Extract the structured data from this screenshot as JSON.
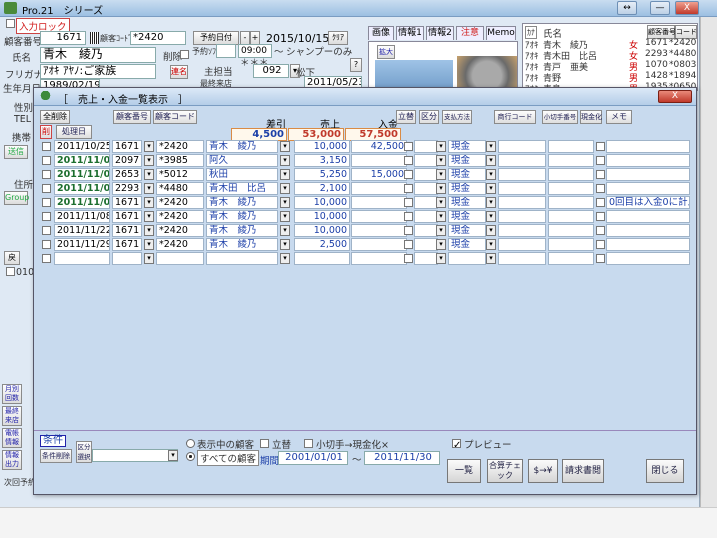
{
  "app": {
    "title": "Pro.21　シリーズ",
    "minimize": "—",
    "close": "X",
    "restore": "↔"
  },
  "form": {
    "input_lock_label": "入力ロック",
    "customer_no_label": "顧客番号",
    "customer_no": "1671",
    "customer_code_label": "顧客ｺｰﾄﾞ",
    "customer_code": "*2420",
    "reservation_date_btn": "予約日付",
    "date_prev": "-",
    "date_next": "+",
    "reservation_date": "2015/10/15",
    "clear_btn": "ｸﾘｱ",
    "name_label": "氏名",
    "name": "青木　綾乃",
    "delete_label": "削除",
    "reservation_time_label": "予約ｿﾌﾄ",
    "time": "09:00",
    "time_tilde": "～",
    "menu": "シャンプーのみ",
    "stars": "＊＊＊",
    "help_btn": "?",
    "kana_label": "フリガナ",
    "kana": "ｱｵｷ ｱﾔﾉ:ご家族",
    "contact_btn": "連名",
    "staff_label": "主担当",
    "staff_code": "092",
    "staff_name": "松下",
    "birthday_label": "生年月日",
    "birthday": "1989/02/19",
    "last_visit_label": "最終来店",
    "last_visit": "2011/05/23",
    "gender_label": "性別",
    "tel_label": "TEL",
    "mobile_label": "携帯",
    "send_btn": "送信",
    "address_label": "住所",
    "group_btn": "Group",
    "return_btn": "戻",
    "side_btn1": "月別回数",
    "side_btn2": "最終来店",
    "side_btn3": "電帳情報",
    "side_btn4": "情報出力",
    "side_label": "次回予約",
    "code_sample": "010"
  },
  "tabs": [
    "画像",
    "情報1",
    "情報2",
    "注意",
    "Memo"
  ],
  "image_panel": {
    "expand_btn": "拡大"
  },
  "customer_list": {
    "header_kana": "ｶﾅ",
    "header_name": "氏名",
    "header_no": "顧客番号",
    "header_code": "コード",
    "rows": [
      {
        "kana": "ｱｵｷ",
        "name": "青木　綾乃",
        "gender": "女",
        "no": "1671",
        "code": "*2420"
      },
      {
        "kana": "ｱｵｷ",
        "name": "青木田　比呂",
        "gender": "女",
        "no": "2293",
        "code": "*4480"
      },
      {
        "kana": "ｱｵｷ",
        "name": "青戸　亜美",
        "gender": "男",
        "no": "1070",
        "code": "*0803"
      },
      {
        "kana": "ｱｵｷ",
        "name": "青野",
        "gender": "男",
        "no": "1428",
        "code": "*1894"
      },
      {
        "kana": "ｱｵｷ",
        "name": "青島",
        "gender": "男",
        "no": "1935",
        "code": "*0650"
      }
    ]
  },
  "dialog": {
    "title": "［　売上・入金一覧表示　］",
    "close": "X",
    "delete_all_btn": "全削除",
    "delete_marker": "削",
    "processing_date_btn": "処理日",
    "customer_no_btn": "顧客番号",
    "customer_code_btn": "顧客コード",
    "col_balance": "差引",
    "col_sales": "売上",
    "col_payment": "入金",
    "col_transfer_btn": "立替",
    "col_category_btn": "区分",
    "col_payment_method_btn": "支払方法",
    "col_product_code_btn": "商行コード",
    "col_check_no_btn": "小切手番号",
    "col_cash_btn": "現金化",
    "col_memo_btn": "メモ",
    "total_balance": "4,500",
    "total_sales": "53,000",
    "total_payment": "57,500",
    "rows": [
      {
        "date": "2011/10/25",
        "bold": false,
        "no": "1671",
        "code": "*2420",
        "name": "青木　綾乃",
        "sales": "10,000",
        "payment": "42,500",
        "method": "現金",
        "memo": ""
      },
      {
        "date": "2011/11/01",
        "bold": true,
        "no": "2097",
        "code": "*3985",
        "name": "阿久",
        "sales": "3,150",
        "payment": "",
        "method": "現金",
        "memo": ""
      },
      {
        "date": "2011/11/01",
        "bold": true,
        "no": "2653",
        "code": "*5012",
        "name": "秋田",
        "sales": "5,250",
        "payment": "15,000",
        "method": "現金",
        "memo": ""
      },
      {
        "date": "2011/11/01",
        "bold": true,
        "no": "2293",
        "code": "*4480",
        "name": "青木田　比呂",
        "sales": "2,100",
        "payment": "",
        "method": "現金",
        "memo": ""
      },
      {
        "date": "2011/11/01",
        "bold": true,
        "no": "1671",
        "code": "*2420",
        "name": "青木　綾乃",
        "sales": "10,000",
        "payment": "",
        "method": "現金",
        "memo": "0回目は入金0に計上する"
      },
      {
        "date": "2011/11/08",
        "bold": false,
        "no": "1671",
        "code": "*2420",
        "name": "青木　綾乃",
        "sales": "10,000",
        "payment": "",
        "method": "現金",
        "memo": ""
      },
      {
        "date": "2011/11/22",
        "bold": false,
        "no": "1671",
        "code": "*2420",
        "name": "青木　綾乃",
        "sales": "10,000",
        "payment": "",
        "method": "現金",
        "memo": ""
      },
      {
        "date": "2011/11/29",
        "bold": false,
        "no": "1671",
        "code": "*2420",
        "name": "青木　綾乃",
        "sales": "2,500",
        "payment": "",
        "method": "現金",
        "memo": ""
      }
    ],
    "conditions_label": "条件",
    "condition_clear_btn": "条件削除",
    "classification_btn": "区分",
    "classification_sub": "選択",
    "radio_displayed": "表示中の顧客",
    "radio_all": "すべての顧客",
    "period_label": "期間",
    "period_from": "2001/01/01",
    "period_tilde": "～",
    "period_to": "2011/11/30",
    "transfer_check": "立替",
    "check_cash": "小切手→現金化×",
    "preview_check": "プレビュー",
    "list_btn": "一覧",
    "total_check_btn": "合算チェック",
    "yen_btn": "$→¥",
    "invoice_btn": "請求書閲",
    "close_btn": "閉じる"
  }
}
